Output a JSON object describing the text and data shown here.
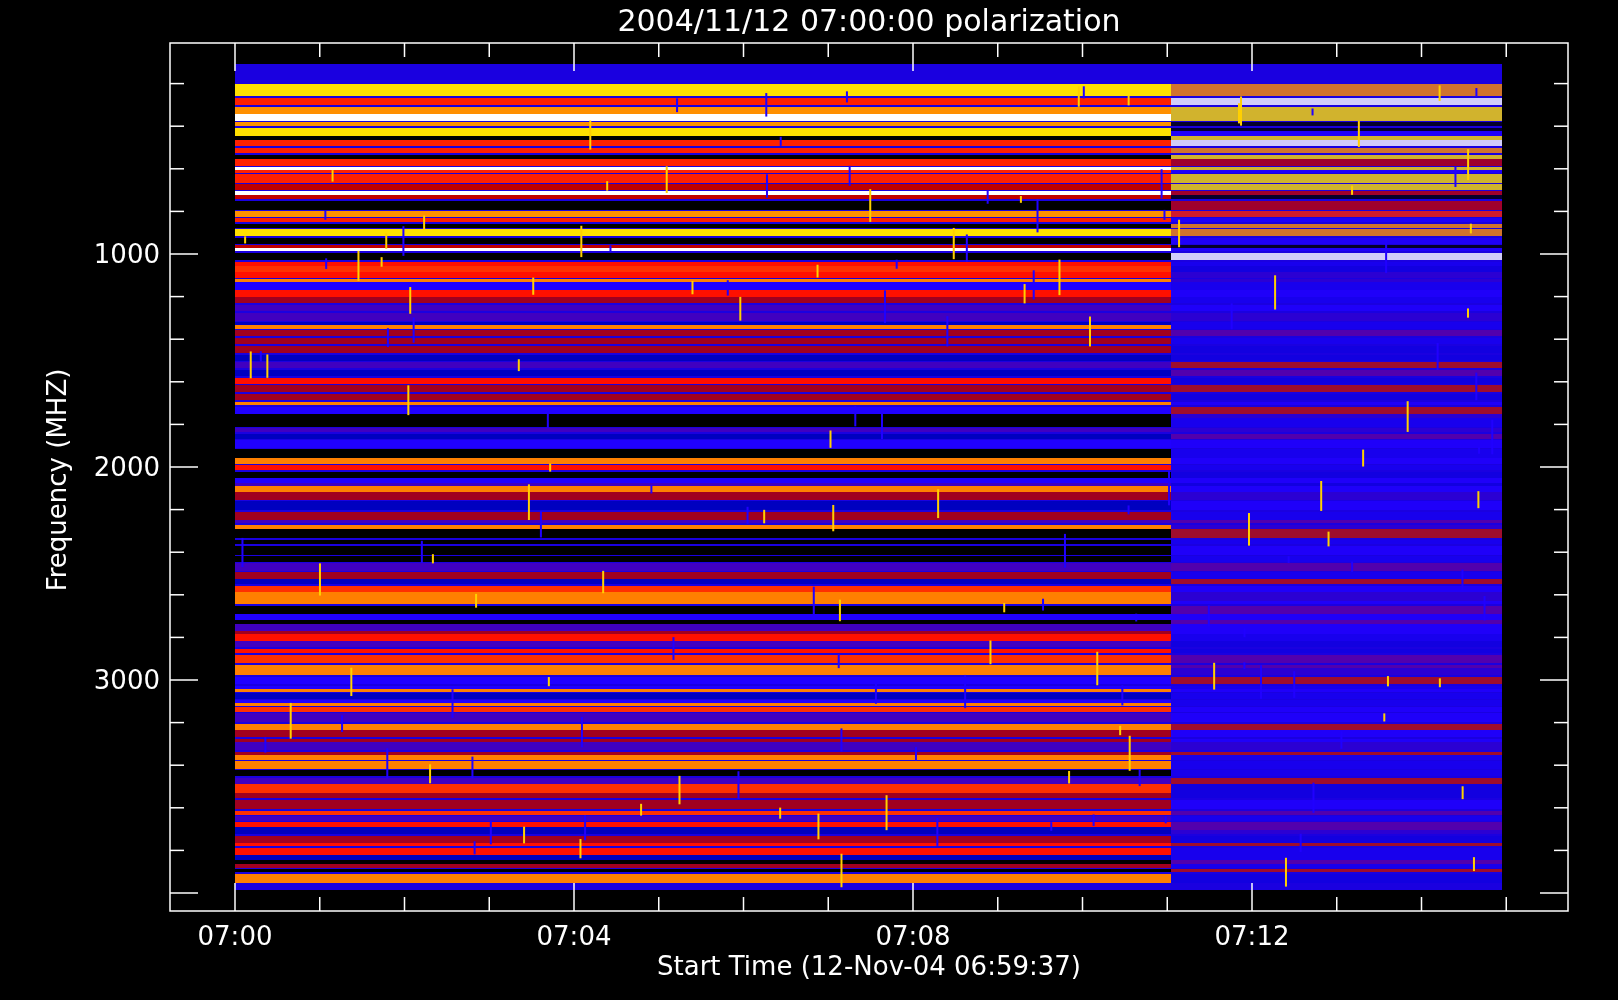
{
  "title": "2004/11/12 07:00:00 polarization",
  "x_axis": {
    "label": "Start Time (12-Nov-04 06:59:37)",
    "ticks": [
      "07:00",
      "07:04",
      "07:08",
      "07:12"
    ]
  },
  "y_axis": {
    "label": "Frequency (MHZ)",
    "ticks": [
      "1000",
      "2000",
      "3000"
    ]
  }
}
